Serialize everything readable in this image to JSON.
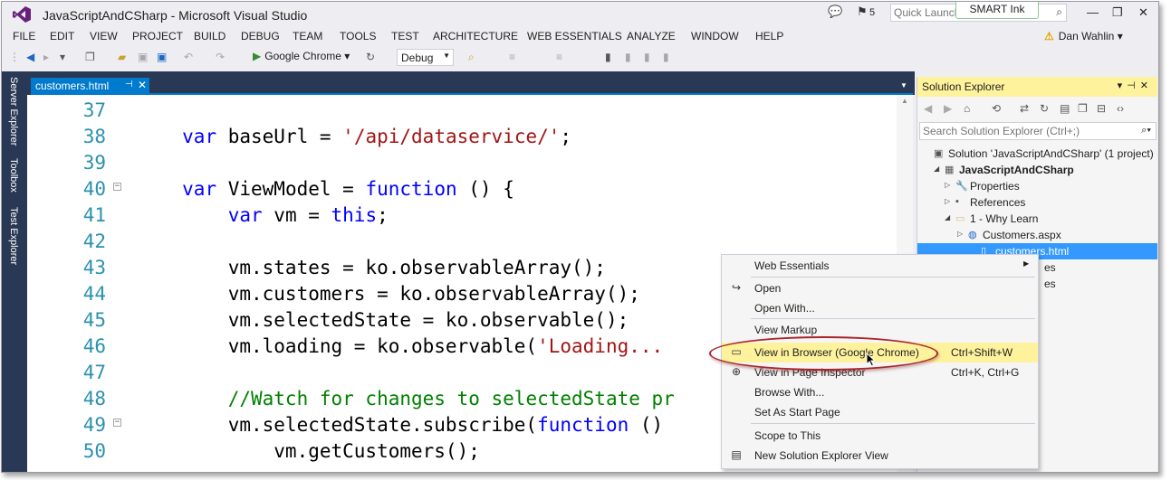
{
  "window": {
    "title": "JavaScriptAndCSharp - Microsoft Visual Studio",
    "notification_count": "5",
    "quick_launch_placeholder": "Quick Launch",
    "smart_ink": "SMART Ink"
  },
  "menu": {
    "items": [
      "FILE",
      "EDIT",
      "VIEW",
      "PROJECT",
      "BUILD",
      "DEBUG",
      "TEAM",
      "TOOLS",
      "TEST",
      "ARCHITECTURE",
      "WEB ESSENTIALS",
      "ANALYZE",
      "WINDOW",
      "HELP"
    ],
    "user": "Dan Wahlin"
  },
  "toolbar": {
    "run_target": "Google Chrome",
    "configuration": "Debug"
  },
  "side_tabs": [
    "Server Explorer",
    "Toolbox",
    "Test Explorer"
  ],
  "document_tab": {
    "label": "customers.html"
  },
  "code": [
    {
      "num": "37",
      "parts": []
    },
    {
      "num": "38",
      "parts": [
        [
          "",
          "        "
        ],
        [
          "kw",
          "var"
        ],
        [
          "",
          " baseUrl = "
        ],
        [
          "str",
          "'/api/dataservice/'"
        ],
        [
          "",
          ";"
        ]
      ]
    },
    {
      "num": "39",
      "parts": []
    },
    {
      "num": "40",
      "fold": true,
      "parts": [
        [
          "",
          "        "
        ],
        [
          "kw",
          "var"
        ],
        [
          "",
          " ViewModel = "
        ],
        [
          "kw",
          "function"
        ],
        [
          "",
          " () {"
        ]
      ]
    },
    {
      "num": "41",
      "parts": [
        [
          "",
          "            "
        ],
        [
          "kw",
          "var"
        ],
        [
          "",
          " vm = "
        ],
        [
          "kw",
          "this"
        ],
        [
          "",
          ";"
        ]
      ]
    },
    {
      "num": "42",
      "parts": []
    },
    {
      "num": "43",
      "parts": [
        [
          "",
          "            vm.states = ko.observableArray();"
        ]
      ]
    },
    {
      "num": "44",
      "parts": [
        [
          "",
          "            vm.customers = ko.observableArray();"
        ]
      ]
    },
    {
      "num": "45",
      "parts": [
        [
          "",
          "            vm.selectedState = ko.observable();"
        ]
      ]
    },
    {
      "num": "46",
      "parts": [
        [
          "",
          "            vm.loading = ko.observable("
        ],
        [
          "str",
          "'Loading..."
        ]
      ]
    },
    {
      "num": "47",
      "parts": []
    },
    {
      "num": "48",
      "parts": [
        [
          "",
          "            "
        ],
        [
          "cmt",
          "//Watch for changes to selectedState pr"
        ]
      ]
    },
    {
      "num": "49",
      "fold": true,
      "parts": [
        [
          "",
          "            vm.selectedState.subscribe("
        ],
        [
          "kw",
          "function"
        ],
        [
          "",
          " ()"
        ]
      ]
    },
    {
      "num": "50",
      "parts": [
        [
          "",
          "                vm.getCustomers();"
        ]
      ]
    }
  ],
  "solution_explorer": {
    "title": "Solution Explorer",
    "search_placeholder": "Search Solution Explorer (Ctrl+;)",
    "tree": [
      {
        "label": "Solution 'JavaScriptAndCSharp' (1 project)",
        "icon": "solution-icon"
      },
      {
        "label": "JavaScriptAndCSharp",
        "icon": "project-icon",
        "bold": true
      },
      {
        "label": "Properties",
        "icon": "wrench-icon"
      },
      {
        "label": "References",
        "icon": "references-icon"
      },
      {
        "label": "1 - Why Learn",
        "icon": "folder-icon"
      },
      {
        "label": "Customers.aspx",
        "icon": "aspx-icon"
      },
      {
        "label": "customers.html",
        "icon": "html-file-icon",
        "selected": true
      },
      {
        "label": "es",
        "icon": ""
      },
      {
        "label": "es",
        "icon": ""
      }
    ]
  },
  "context_menu": {
    "items": [
      {
        "label": "Web Essentials",
        "shortcut": "",
        "submenu": true,
        "icon": ""
      },
      {
        "label": "Open",
        "shortcut": "",
        "icon": "open-icon"
      },
      {
        "label": "Open With...",
        "shortcut": "",
        "icon": ""
      },
      {
        "label": "View Markup",
        "shortcut": "",
        "icon": ""
      },
      {
        "label": "View in Browser (Google Chrome)",
        "shortcut": "Ctrl+Shift+W",
        "icon": "browser-icon",
        "highlighted": true
      },
      {
        "label": "View in Page Inspector",
        "shortcut": "Ctrl+K, Ctrl+G",
        "icon": "inspector-icon"
      },
      {
        "label": "Browse With...",
        "shortcut": "",
        "icon": ""
      },
      {
        "label": "Set As Start Page",
        "shortcut": "",
        "icon": ""
      },
      {
        "label": "Scope to This",
        "shortcut": "",
        "icon": ""
      },
      {
        "label": "New Solution Explorer View",
        "shortcut": "",
        "icon": "new-view-icon"
      }
    ]
  },
  "colors": {
    "accent": "#007acc",
    "menu_highlight": "#fff29d",
    "annotation_oval": "#a8262c",
    "dark_chrome": "#293955"
  }
}
